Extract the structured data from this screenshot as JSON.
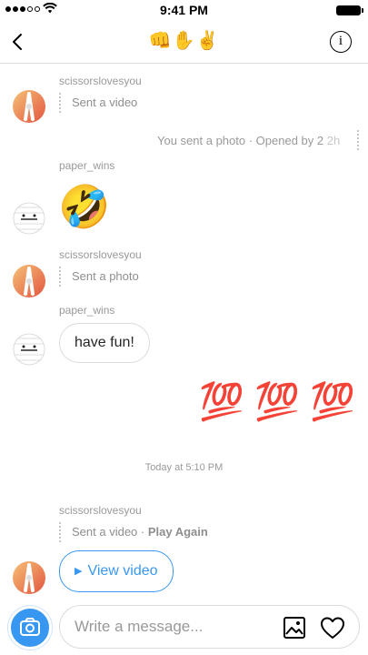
{
  "status_bar": {
    "time": "9:41 PM"
  },
  "header": {
    "title": "👊✋✌️",
    "info_label": "i"
  },
  "messages": {
    "m1_user": "scissorslovesyou",
    "m1_activity": "Sent a video",
    "m2_status": "You sent a photo · Opened by 2",
    "m2_age": "2h",
    "m3_user": "paper_wins",
    "m3_emoji": "🤣",
    "m4_user": "scissorslovesyou",
    "m4_activity": "Sent a photo",
    "m5_user": "paper_wins",
    "m5_text": "have fun!",
    "m6_emoji": "💯 💯 💯",
    "divider": "Today at 5:10 PM",
    "m7_user": "scissorslovesyou",
    "m7_activity": "Sent a video · ",
    "m7_play_again": "Play Again",
    "m7_button": "View video",
    "m7_play_glyph": "▶"
  },
  "composer": {
    "placeholder": "Write a message..."
  },
  "colors": {
    "accent": "#3897f0",
    "border": "#dbdbdb",
    "muted": "#999999",
    "emoji_red": "#d0021b"
  },
  "icons": [
    "back-chevron-icon",
    "info-icon",
    "camera-icon",
    "gallery-icon",
    "heart-icon",
    "play-icon"
  ]
}
